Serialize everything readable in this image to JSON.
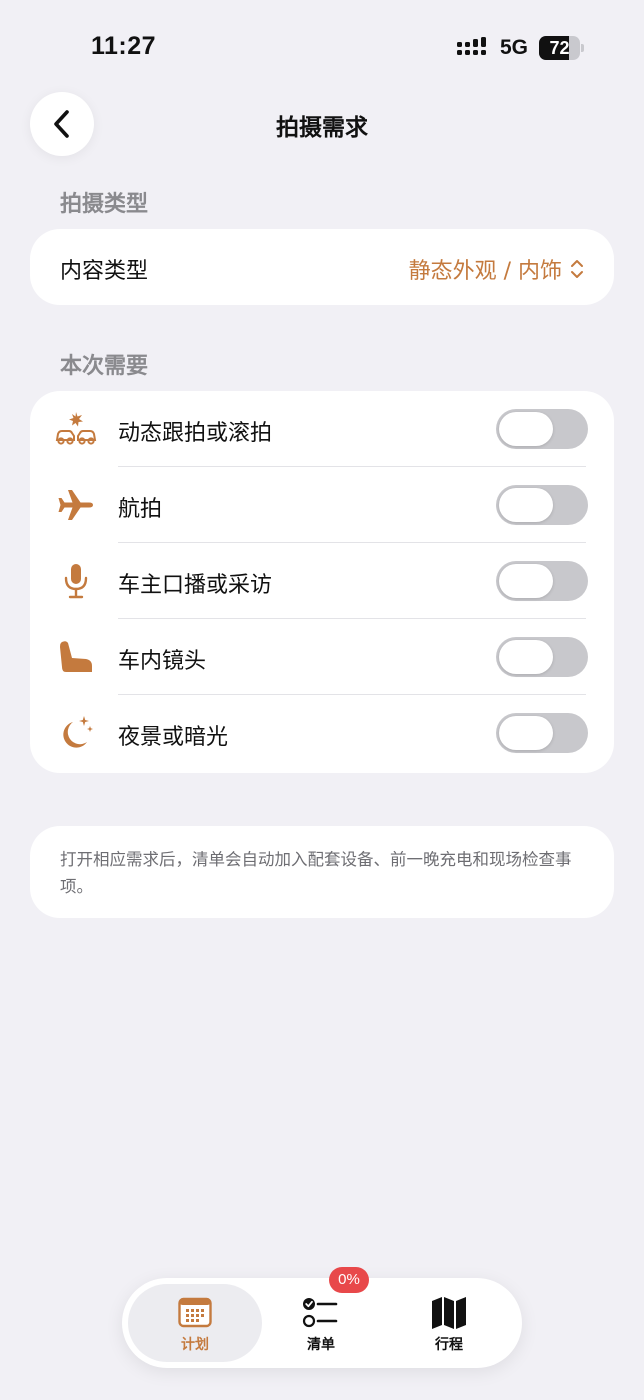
{
  "status_bar": {
    "time": "11:27",
    "network": "5G",
    "battery_level": "72",
    "battery_fraction": 0.72
  },
  "nav": {
    "back_icon": "chevron-left-icon",
    "title": "拍摄需求"
  },
  "shooting_type": {
    "section_title": "拍摄类型",
    "label": "内容类型",
    "value": "静态外观 / 内饰",
    "value_icon": "chevron-up-down-icon"
  },
  "needs": {
    "section_title": "本次需要",
    "items": [
      {
        "label": "动态跟拍或滚拍",
        "icon": "car-tracking-icon",
        "enabled": false
      },
      {
        "label": "航拍",
        "icon": "airplane-icon",
        "enabled": false
      },
      {
        "label": "车主口播或采访",
        "icon": "microphone-icon",
        "enabled": false
      },
      {
        "label": "车内镜头",
        "icon": "car-seat-icon",
        "enabled": false
      },
      {
        "label": "夜景或暗光",
        "icon": "moon-stars-icon",
        "enabled": false
      }
    ]
  },
  "note": {
    "text": "打开相应需求后，清单会自动加入配套设备、前一晚充电和现场检查事项。"
  },
  "tabbar": {
    "tabs": [
      {
        "label": "计划",
        "icon": "calendar-icon",
        "selected": true
      },
      {
        "label": "清单",
        "icon": "checklist-icon",
        "selected": false,
        "badge": "0%"
      },
      {
        "label": "行程",
        "icon": "map-icon",
        "selected": false
      }
    ]
  },
  "colors": {
    "accent": "#c47a3e",
    "background": "#f1f0f5",
    "badge": "#e8484a",
    "toggle_off": "#c8c8cc"
  }
}
